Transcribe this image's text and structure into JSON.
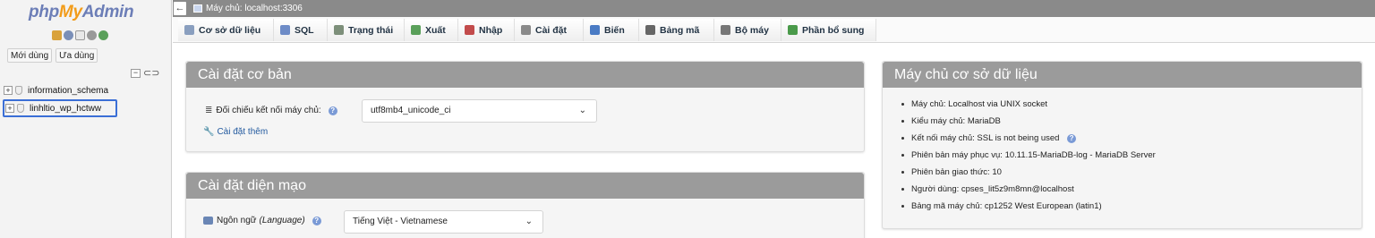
{
  "app": {
    "logo_php": "php",
    "logo_my": "My",
    "logo_admin": "Admin"
  },
  "sidebar": {
    "recent_label": "Mới dùng",
    "favorites_label": "Ưa dùng",
    "databases": [
      "information_schema",
      "linhltio_wp_hctww"
    ],
    "quick_icons": [
      "home-icon",
      "exit-icon",
      "docs-icon",
      "settings-icon",
      "reload-icon"
    ]
  },
  "topbar": {
    "server": "Máy chủ: localhost:3306"
  },
  "tabs": [
    {
      "label": "Cơ sở dữ liệu",
      "icon": "database-icon",
      "color": "#8a9fbf"
    },
    {
      "label": "SQL",
      "icon": "sql-icon",
      "color": "#6e8cc7"
    },
    {
      "label": "Trạng thái",
      "icon": "status-icon",
      "color": "#7d8f7a"
    },
    {
      "label": "Xuất",
      "icon": "export-icon",
      "color": "#5aa05a"
    },
    {
      "label": "Nhập",
      "icon": "import-icon",
      "color": "#c24b4b"
    },
    {
      "label": "Cài đặt",
      "icon": "wrench-icon",
      "color": "#8a8a8a"
    },
    {
      "label": "Biến",
      "icon": "variables-icon",
      "color": "#4a7bc4"
    },
    {
      "label": "Bảng mã",
      "icon": "charset-icon",
      "color": "#666666"
    },
    {
      "label": "Bộ máy",
      "icon": "engine-icon",
      "color": "#777777"
    },
    {
      "label": "Phần bổ sung",
      "icon": "plugin-icon",
      "color": "#4a9a4a"
    }
  ],
  "basic_settings": {
    "title": "Cài đặt cơ bản",
    "collation_label": "Đối chiếu kết nối máy chủ:",
    "collation_value": "utf8mb4_unicode_ci",
    "more_settings": "Cài đặt thêm"
  },
  "appearance_settings": {
    "title": "Cài đặt diện mạo",
    "language_label": "Ngôn ngữ",
    "language_label_en": "(Language)",
    "language_value": "Tiếng Việt - Vietnamese"
  },
  "db_server": {
    "title": "Máy chủ cơ sở dữ liệu",
    "items": [
      "Máy chủ: Localhost via UNIX socket",
      "Kiểu máy chủ: MariaDB",
      "Kết nối máy chủ: SSL is not being used",
      "Phiên bản máy phục vụ: 10.11.15-MariaDB-log - MariaDB Server",
      "Phiên bản giao thức: 10",
      "Người dùng: cpses_lit5z9m8mn@localhost",
      "Bảng mã máy chủ: cp1252 West European (latin1)"
    ]
  }
}
